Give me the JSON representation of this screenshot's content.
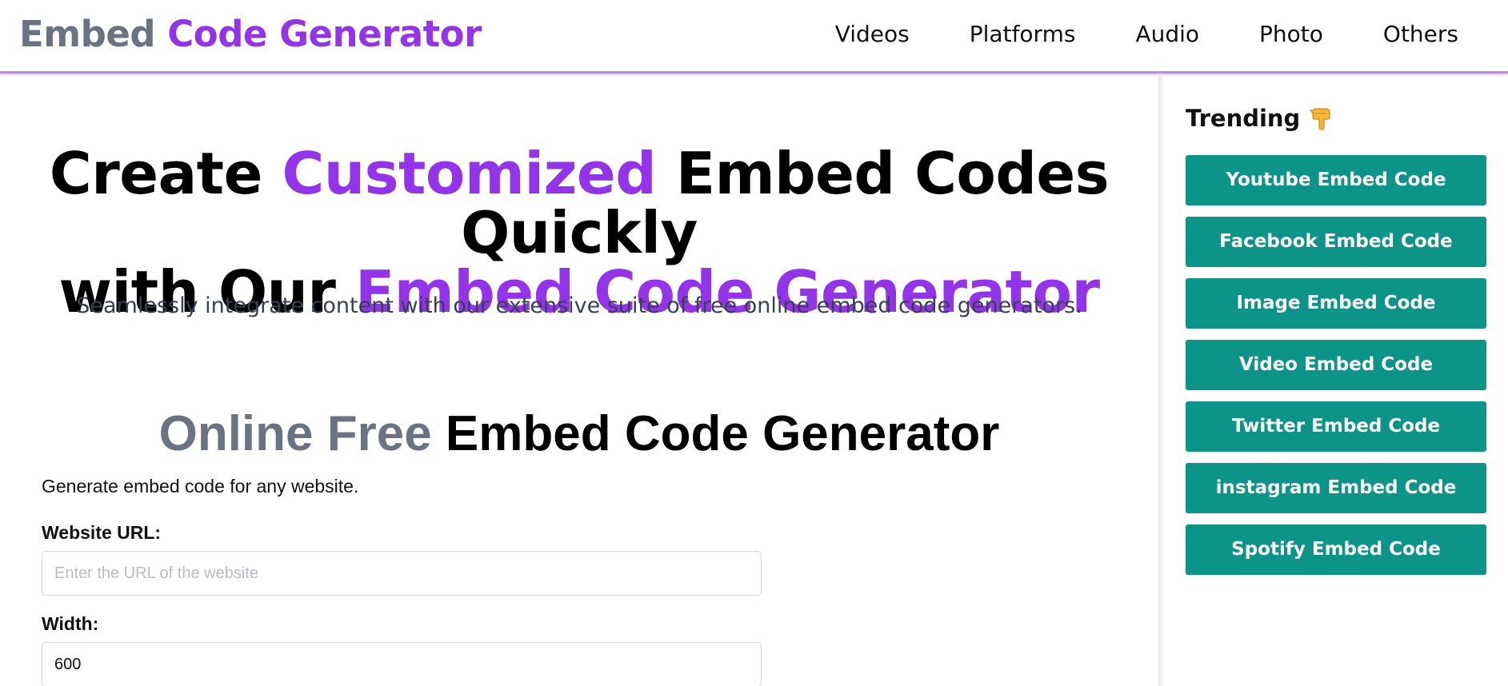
{
  "header": {
    "logo_part1": "Embed",
    "logo_part2": "Code Generator",
    "nav": [
      "Videos",
      "Platforms",
      "Audio",
      "Photo",
      "Others"
    ]
  },
  "hero": {
    "title_1": "Create ",
    "title_2": "Customized",
    "title_3": " Embed Codes Quickly",
    "title_4": "with Our ",
    "title_5": "Embed Code Generator",
    "subtitle": "Seamlessly integrate content with our extensive suite of free online embed code generators."
  },
  "tool": {
    "title_gray": "Online Free",
    "title_black": " Embed Code Generator",
    "intro": "Generate embed code for any website.",
    "url_label": "Website URL:",
    "url_placeholder": "Enter the URL of the website",
    "url_value": "",
    "width_label": "Width:",
    "width_value": "600"
  },
  "sidebar": {
    "heading": "Trending",
    "heading_icon": "pointing-down-hand-icon",
    "items": [
      "Youtube Embed Code",
      "Facebook Embed Code",
      "Image Embed Code",
      "Video Embed Code",
      "Twitter Embed Code",
      "instagram Embed Code",
      "Spotify Embed Code"
    ]
  },
  "colors": {
    "accent_purple": "#9333ea",
    "muted_gray": "#6b7280",
    "button_teal": "#0d9488"
  }
}
